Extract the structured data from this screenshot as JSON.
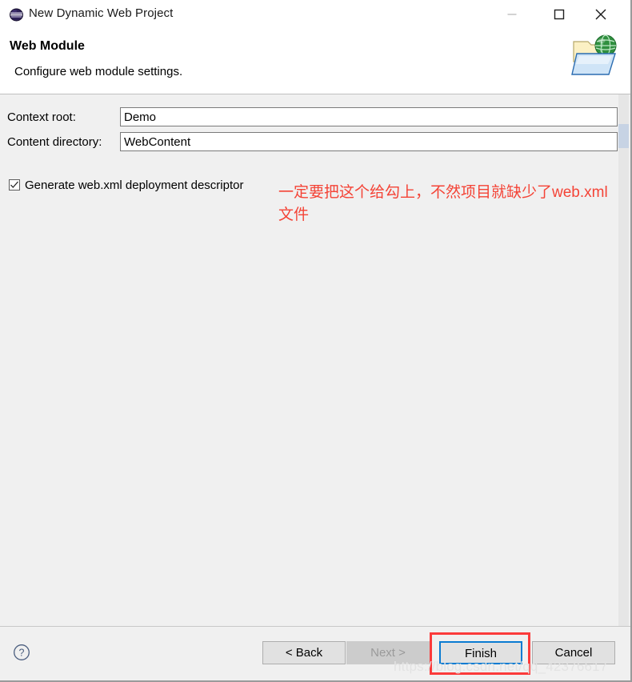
{
  "window": {
    "title": "New Dynamic Web Project",
    "app_icon": "eclipse-sphere-icon",
    "controls": {
      "minimize": "minimize-icon",
      "maximize": "maximize-icon",
      "close": "close-icon"
    }
  },
  "header": {
    "title": "Web Module",
    "description": "Configure web module settings.",
    "banner_icon": "web-folder-globe-icon"
  },
  "form": {
    "context_root": {
      "label": "Context root:",
      "value": "Demo",
      "placeholder": ""
    },
    "content_directory": {
      "label": "Content directory:",
      "value": "WebContent",
      "placeholder": ""
    },
    "generate_webxml": {
      "label": "Generate web.xml deployment descriptor",
      "checked": true
    }
  },
  "annotation": {
    "text": "一定要把这个给勾上，不然项目就缺少了web.xml文件",
    "color": "#f44336"
  },
  "buttons": {
    "help": "?",
    "back": "< Back",
    "next": "Next >",
    "finish": "Finish",
    "cancel": "Cancel"
  },
  "highlight": {
    "target": "finish",
    "color": "#fb3b3b"
  },
  "watermark": {
    "text": "https://blog.csdn.net/qq_42376617"
  },
  "colors": {
    "dialog_background": "#f0f0f0",
    "header_background": "#ffffff",
    "focus_border": "#0a7bd1",
    "annotation_red": "#f44336",
    "scroll_thumb": "#c7d3e4"
  }
}
